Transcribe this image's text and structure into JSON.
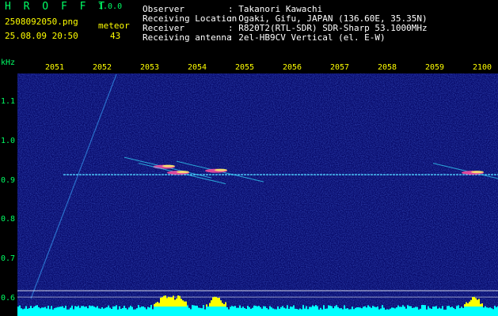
{
  "header": {
    "app_title": "H R O F F T",
    "app_version": "1.0.0",
    "file_name": "2508092050.png",
    "count_label": "meteor",
    "timestamp": "25.08.09 20:50",
    "count_value": "43",
    "info": [
      {
        "label": "Observer",
        "value": ": Takanori Kawachi"
      },
      {
        "label": "Receiving Location",
        "value": ": Ogaki, Gifu, JAPAN (136.60E, 35.35N)"
      },
      {
        "label": "Receiver",
        "value": ": R820T2(RTL-SDR) SDR-Sharp 53.1000MHz"
      },
      {
        "label": "Receiving antenna",
        "value": ": 2el-HB9CV Vertical (el. E-W)"
      }
    ]
  },
  "colors": {
    "background": "#000000",
    "text_header": "#ffff00",
    "text_title": "#00ff66",
    "spectrogram_bg": "#070a6a",
    "carrier": "#4fd0ff",
    "histogram": "#00ffff",
    "histogram_peak": "#ffff00"
  },
  "chart_data": {
    "type": "heatmap",
    "y_unit_label": "kHz",
    "x_ticks": [
      "2051",
      "2052",
      "2053",
      "2054",
      "2055",
      "2056",
      "2057",
      "2058",
      "2059",
      "2100"
    ],
    "y_ticks": [
      "1.1",
      "1.0",
      "0.9",
      "0.8",
      "0.7",
      "0.6"
    ],
    "x_range_minutes": [
      50,
      60
    ],
    "y_range_khz": [
      0.58,
      1.18
    ],
    "carrier_khz": 0.915,
    "lower_band_khz": 0.62,
    "meteor_echoes": [
      {
        "t": 53.3,
        "khz": 0.935
      },
      {
        "t": 53.6,
        "khz": 0.92
      },
      {
        "t": 54.4,
        "khz": 0.925
      },
      {
        "t": 59.8,
        "khz": 0.92
      }
    ]
  }
}
